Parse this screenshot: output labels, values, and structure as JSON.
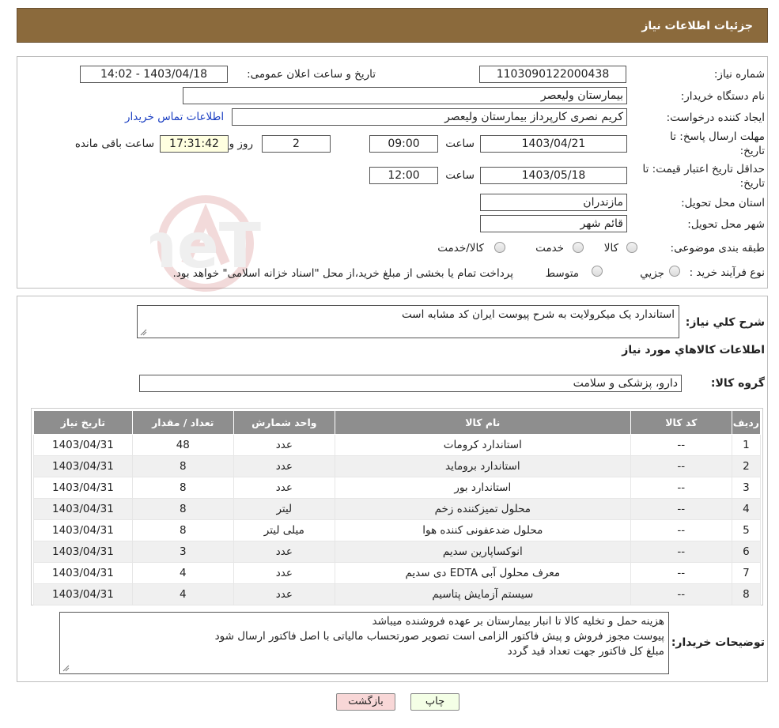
{
  "header": {
    "title": "جزئیات اطلاعات نیاز"
  },
  "form": {
    "need_number_label": "شماره نیاز:",
    "need_number": "1103090122000438",
    "announce_label": "تاریخ و ساعت اعلان عمومی:",
    "announce_value": "1403/04/18 - 14:02",
    "buyer_org_label": "نام دستگاه خریدار:",
    "buyer_org": "بیمارستان ولیعصر",
    "creator_label": "ایجاد کننده درخواست:",
    "creator": "کریم نصری کارپرداز بیمارستان ولیعصر",
    "contact_link": "اطلاعات تماس خریدار",
    "deadline_label": "مهلت ارسال پاسخ: تا",
    "deadline_label2": "تاریخ:",
    "deadline_date": "1403/04/21",
    "time_label": "ساعت",
    "deadline_time": "09:00",
    "days_value": "2",
    "days_label": "روز و",
    "remaining_value": "17:31:42",
    "remaining_label": "ساعت باقی مانده",
    "validity_label": "حداقل تاریخ اعتبار قیمت: تا",
    "validity_label2": "تاریخ:",
    "validity_date": "1403/05/18",
    "validity_time": "12:00",
    "province_label": "استان محل تحویل:",
    "province": "مازندران",
    "city_label": "شهر محل تحویل:",
    "city": "قائم شهر",
    "category_label": "طبقه بندی موضوعی:",
    "category_options": [
      "کالا",
      "خدمت",
      "کالا/خدمت"
    ],
    "process_label": "نوع فرآیند خرید :",
    "process_options": [
      "جزیي",
      "متوسط"
    ],
    "process_note": "پرداخت تمام یا بخشی از مبلغ خرید،از محل \"اسناد خزانه اسلامی\" خواهد بود."
  },
  "details": {
    "general_desc_label": "شرح کلي نياز:",
    "general_desc": "استاندارد یک میکرولایت به شرح پیوست   ایران کد مشابه است",
    "goods_info_title": "اطلاعات کالاهاي مورد نياز",
    "goods_group_label": "گروه کالا:",
    "goods_group": "دارو، پزشکی و سلامت"
  },
  "table": {
    "headers": [
      "ردیف",
      "کد کالا",
      "نام کالا",
      "واحد شمارش",
      "تعداد / مقدار",
      "تاریخ نیاز"
    ],
    "rows": [
      [
        "1",
        "--",
        "استاندارد کرومات",
        "عدد",
        "48",
        "1403/04/31"
      ],
      [
        "2",
        "--",
        "استاندارد برومايد",
        "عدد",
        "8",
        "1403/04/31"
      ],
      [
        "3",
        "--",
        "استاندارد بور",
        "عدد",
        "8",
        "1403/04/31"
      ],
      [
        "4",
        "--",
        "محلول تمیزکننده زخم",
        "لیتر",
        "8",
        "1403/04/31"
      ],
      [
        "5",
        "--",
        "محلول ضدعفونی کننده هوا",
        "میلی لیتر",
        "8",
        "1403/04/31"
      ],
      [
        "6",
        "--",
        "انوکساپارین سدیم",
        "عدد",
        "3",
        "1403/04/31"
      ],
      [
        "7",
        "--",
        "معرف محلول آبی EDTA دی سدیم",
        "عدد",
        "4",
        "1403/04/31"
      ],
      [
        "8",
        "--",
        "سیستم آزمایش پتاسیم",
        "عدد",
        "4",
        "1403/04/31"
      ]
    ]
  },
  "buyer_notes": {
    "label": "توضیحات خریدار:",
    "line1": "هزینه حمل و تخلیه کالا تا انبار بیمارستان بر عهده فروشنده میباشد",
    "line2": "پیوست مجوز فروش و پیش فاکتور الزامی است  تصویر صورتحساب مالیاتی با اصل فاکتور ارسال شود",
    "line3": "مبلغ کل فاکتور جهت تعداد قید گردد"
  },
  "buttons": {
    "print": "چاپ",
    "back": "بازگشت"
  },
  "watermark": {
    "text": "AriaTender.neT"
  },
  "colors": {
    "header": "#8b6a3c",
    "table_header": "#8e8e8e",
    "back_button": "#f8d7d7",
    "print_button": "#f4ffe6"
  },
  "icons": {
    "resize_grip": "resize-grip-icon"
  }
}
